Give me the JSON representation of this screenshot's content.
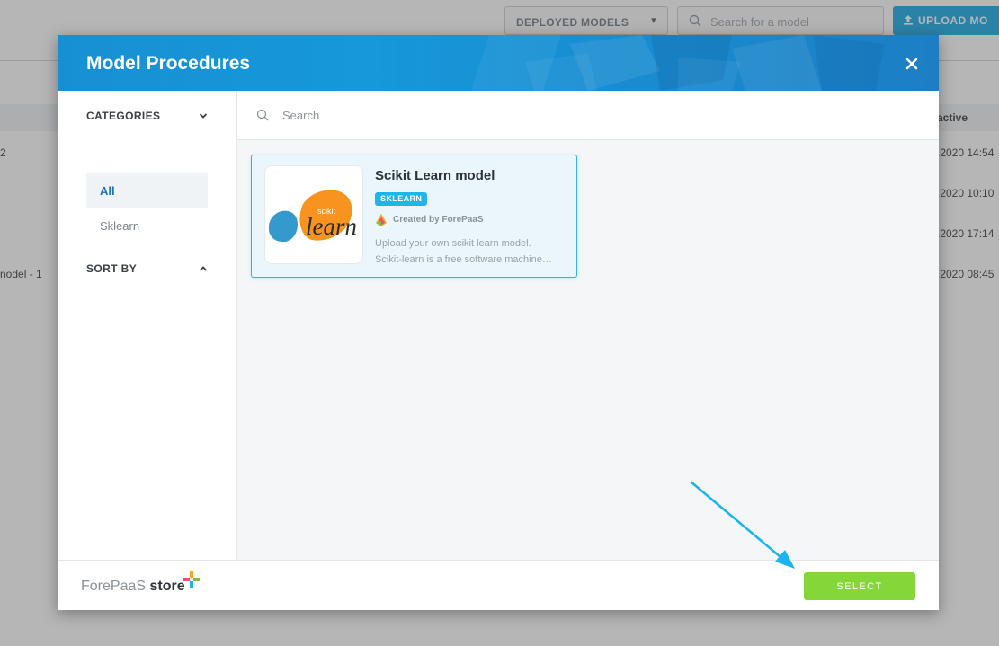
{
  "background": {
    "deployed_select": "DEPLOYED MODELS",
    "search_placeholder": "Search for a model",
    "upload_label": "UPLOAD MO",
    "column_header": "active",
    "left_cells": [
      "2",
      "nodel - 1"
    ],
    "date_cells": [
      ".2020 14:54",
      ".2020 10:10",
      ".2020 17:14",
      ".2020 08:45"
    ]
  },
  "modal": {
    "title": "Model Procedures",
    "sidebar": {
      "categories_label": "CATEGORIES",
      "items": [
        {
          "label": "All",
          "active": true
        },
        {
          "label": "Sklearn",
          "active": false
        }
      ],
      "sort_label": "SORT BY"
    },
    "search": {
      "placeholder": "Search"
    },
    "cards": [
      {
        "title": "Scikit Learn model",
        "tag": "SKLEARN",
        "author": "Created by ForePaaS",
        "description_lines": [
          "Upload your own scikit learn model.",
          "Scikit-learn is a free software machine…"
        ],
        "logo_small": "scikit",
        "logo_big": "learn"
      }
    ],
    "footer": {
      "brand_a": "ForePaaS",
      "brand_b": "store",
      "select_label": "SELECT"
    }
  },
  "colors": {
    "header_blue": "#1790d3",
    "tag_blue": "#1eb4ec",
    "select_green": "#84d639",
    "arrow_blue": "#1cb4ef"
  }
}
